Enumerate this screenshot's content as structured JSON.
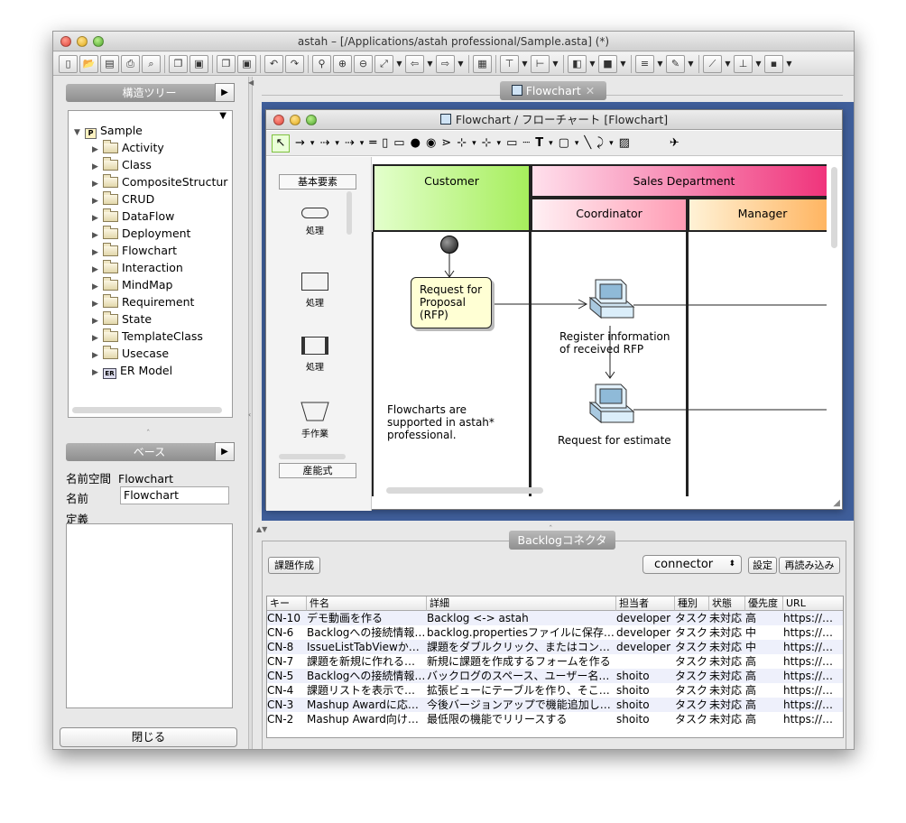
{
  "app": {
    "window_title": "astah – [/Applications/astah professional/Sample.asta] (*)",
    "close_label": "閉じる"
  },
  "structure_tree": {
    "title": "構造ツリー",
    "root": "Sample",
    "items": [
      "Activity",
      "Class",
      "CompositeStructur",
      "CRUD",
      "DataFlow",
      "Deployment",
      "Flowchart",
      "Interaction",
      "MindMap",
      "Requirement",
      "State",
      "TemplateClass",
      "Usecase",
      "ER Model"
    ]
  },
  "base_panel": {
    "title": "ベース",
    "namespace_label": "名前空間",
    "namespace_value": "Flowchart",
    "name_label": "名前",
    "name_value": "Flowchart",
    "definition_label": "定義"
  },
  "diagram": {
    "tab_label": "Flowchart",
    "window_title": "Flowchart / フローチャート [Flowchart]",
    "toolbar_text_tool": "T",
    "palette": {
      "header": "基本要素",
      "items": [
        "処理",
        "処理",
        "処理",
        "手作業"
      ],
      "footer": "産能式"
    },
    "lanes": {
      "customer": "Customer",
      "sales": "Sales Department",
      "coordinator": "Coordinator",
      "manager": "Manager"
    },
    "nodes": {
      "rfp": "Request for\nProposal\n(RFP)",
      "register": "Register information\nof received RFP",
      "estimate": "Request for estimate",
      "note": "Flowcharts are\nsupported in astah*\nprofessional."
    },
    "colors": {
      "customer": "#a6ee5c",
      "sales": "#ef2f78",
      "coordinator": "#ff9cb4",
      "manager": "#ffb15a",
      "note_fill": "#ffffd4"
    }
  },
  "backlog": {
    "title": "Backlogコネクタ",
    "create_button": "課題作成",
    "connector_value": "connector",
    "settings_button": "設定",
    "reload_button": "再読み込み",
    "columns": [
      "キー",
      "件名",
      "詳細",
      "担当者",
      "種別",
      "状態",
      "優先度",
      "URL"
    ],
    "rows": [
      [
        "CN-10",
        "デモ動画を作る",
        "Backlog <-> astah",
        "developer",
        "タスク",
        "未対応",
        "高",
        "https://…"
      ],
      [
        "CN-6",
        "Backlogへの接続情報…",
        "backlog.propertiesファイルに保存…",
        "developer",
        "タスク",
        "未対応",
        "中",
        "https://…"
      ],
      [
        "CN-8",
        "IssueListTabViewか…",
        "課題をダブルクリック、またはコン…",
        "developer",
        "タスク",
        "未対応",
        "中",
        "https://…"
      ],
      [
        "CN-7",
        "課題を新規に作れる…",
        "新規に課題を作成するフォームを作る",
        "",
        "タスク",
        "未対応",
        "高",
        "https://…"
      ],
      [
        "CN-5",
        "Backlogへの接続情報…",
        "バックログのスペース、ユーザー名…",
        "shoito",
        "タスク",
        "未対応",
        "高",
        "https://…"
      ],
      [
        "CN-4",
        "課題リストを表示で…",
        "拡張ビューにテーブルを作り、そこ…",
        "shoito",
        "タスク",
        "未対応",
        "高",
        "https://…"
      ],
      [
        "CN-3",
        "Mashup Awardに応…",
        "今後バージョンアップで機能追加し…",
        "shoito",
        "タスク",
        "未対応",
        "高",
        "https://…"
      ],
      [
        "CN-2",
        "Mashup Award向け…",
        "最低限の機能でリリースする",
        "shoito",
        "タスク",
        "未対応",
        "高",
        "https://…"
      ]
    ]
  }
}
